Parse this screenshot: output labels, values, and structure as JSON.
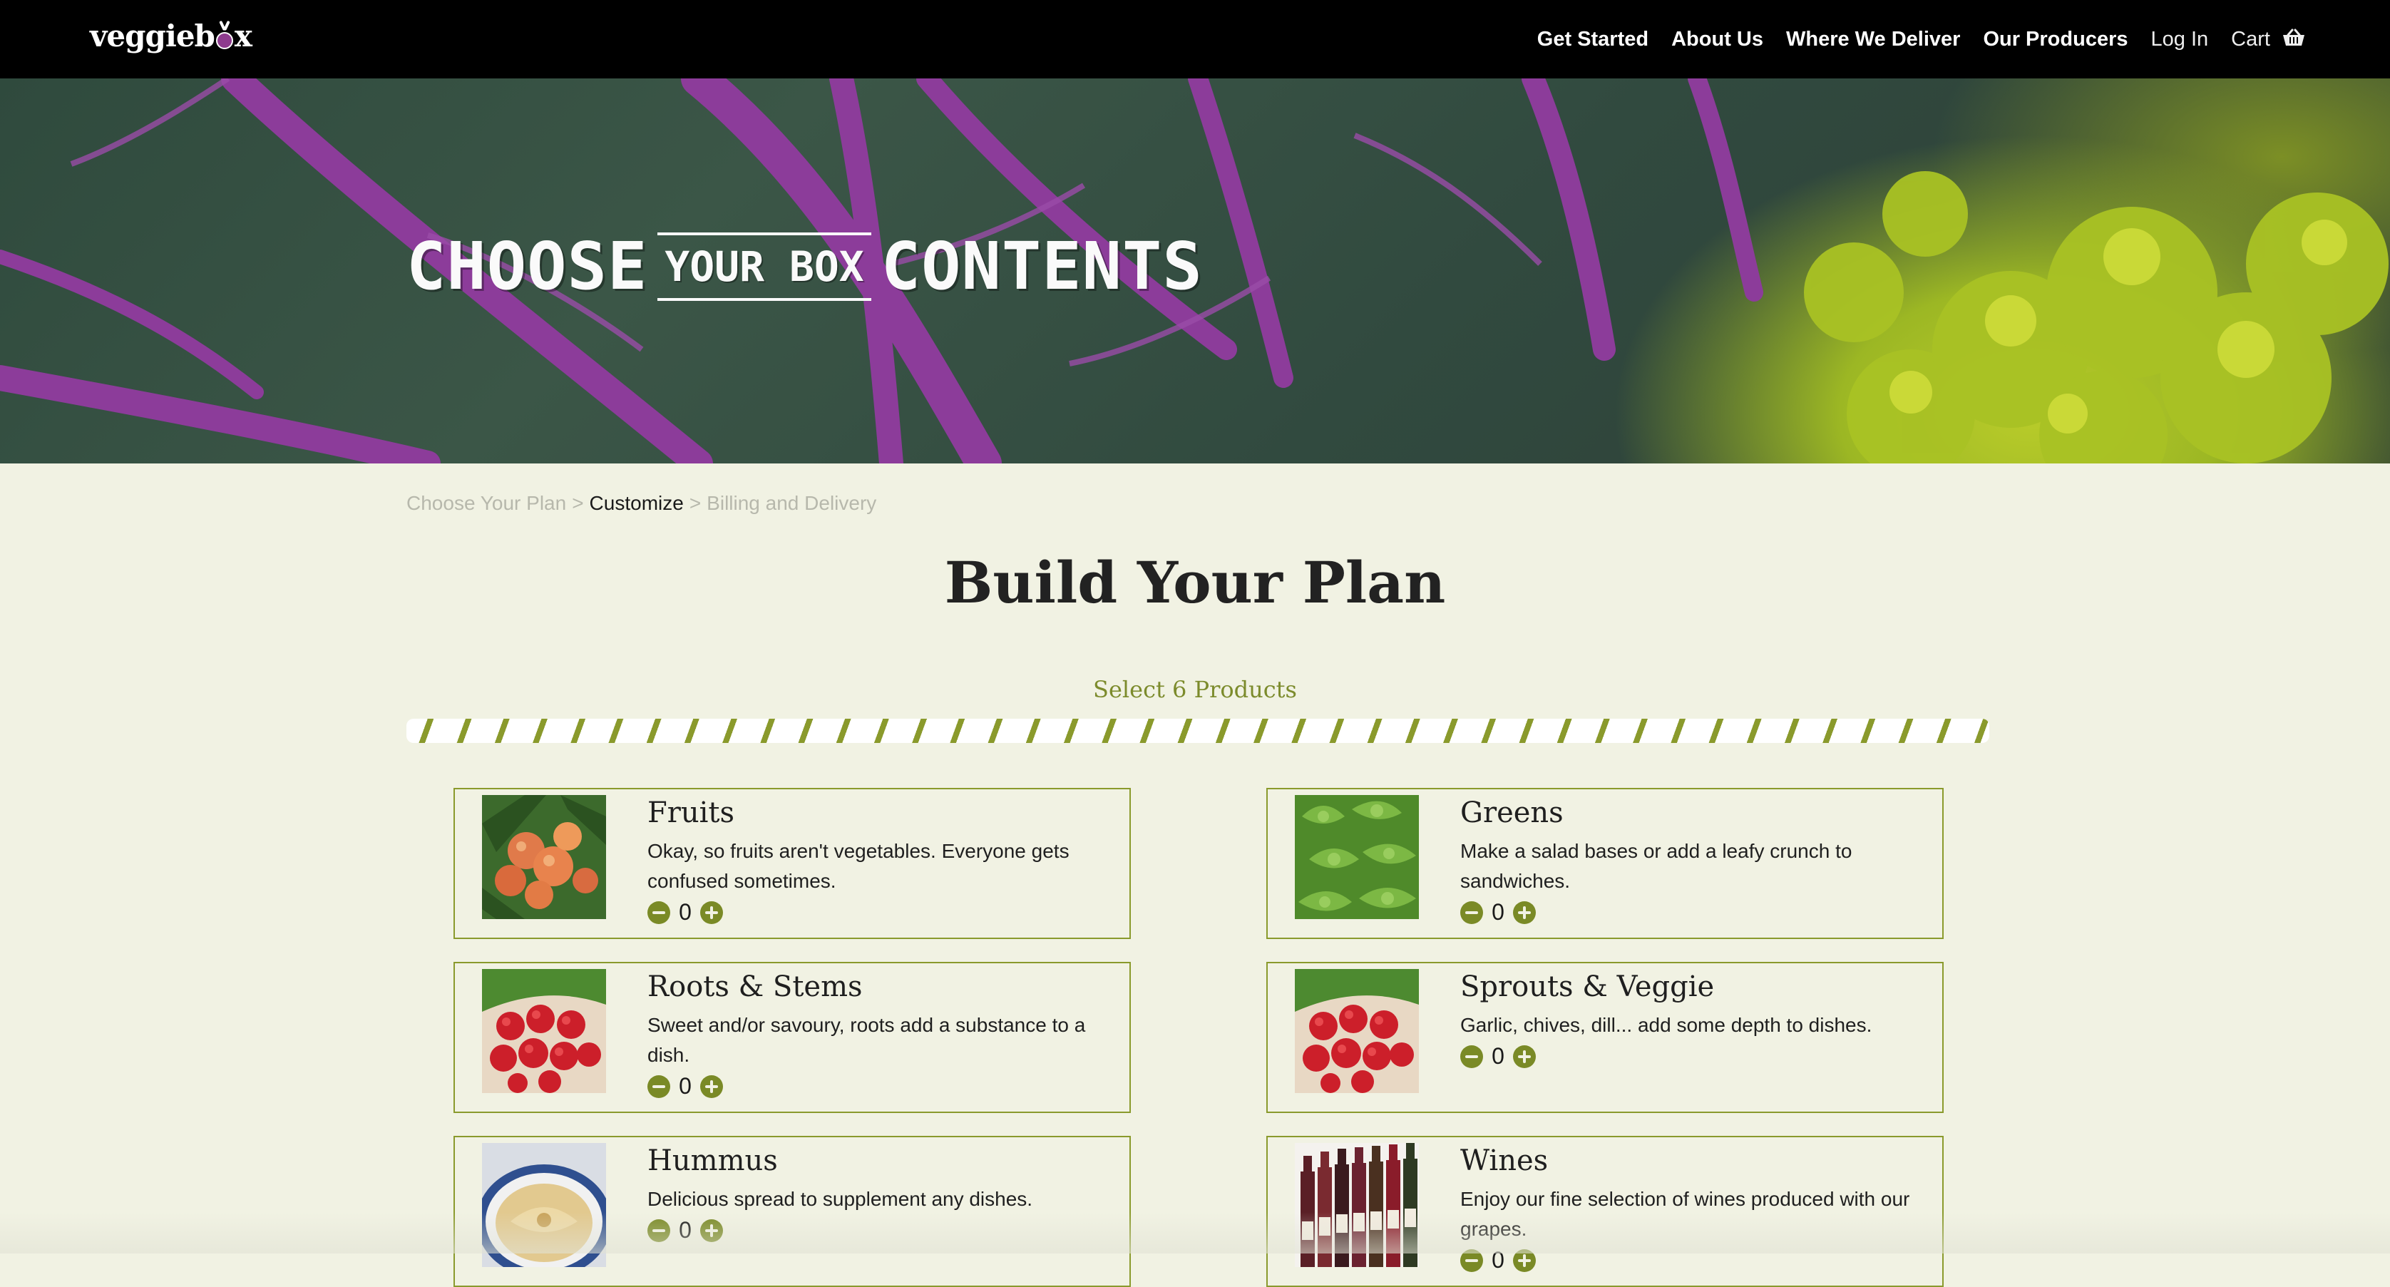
{
  "nav": {
    "logo": "veggieb",
    "logo_tail": "x",
    "links": [
      {
        "label": "Get Started"
      },
      {
        "label": "About Us"
      },
      {
        "label": "Where We Deliver"
      },
      {
        "label": "Our Producers"
      },
      {
        "label": "Log In"
      },
      {
        "label": "Cart"
      }
    ],
    "cart_icon": "basket-icon"
  },
  "hero": {
    "title_a": "CHOOSE",
    "title_b": "YOUR BOX",
    "title_c": "CONTENTS"
  },
  "breadcrumb": {
    "steps": [
      "Choose Your Plan",
      "Customize",
      "Billing and Delivery"
    ],
    "separator": ">",
    "active_index": 1
  },
  "page": {
    "title": "Build Your Plan",
    "select_label": "Select 6 Products",
    "progress_fraction": 0
  },
  "products": [
    {
      "name": "Fruits",
      "description": "Okay, so fruits aren't vegetables. Everyone gets confused sometimes.",
      "qty": "0",
      "image": "peaches-image"
    },
    {
      "name": "Greens",
      "description": "Make a salad bases or add a leafy crunch to sandwiches.",
      "qty": "0",
      "image": "lettuce-image"
    },
    {
      "name": "Roots & Stems",
      "description": "Sweet and/or savoury, roots add a substance to a dish.",
      "qty": "0",
      "image": "radishes-image"
    },
    {
      "name": "Sprouts & Veggie",
      "description": "Garlic, chives, dill... add some depth to dishes.",
      "qty": "0",
      "image": "radishes-image"
    },
    {
      "name": "Hummus",
      "description": "Delicious spread to supplement any dishes.",
      "qty": "0",
      "image": "hummus-image"
    },
    {
      "name": "Wines",
      "description": "Enjoy our fine selection of wines produced with our grapes.",
      "qty": "0",
      "image": "wine-bottles-image"
    }
  ],
  "colors": {
    "nav_bg": "#000000",
    "page_bg": "#f1f2e3",
    "accent": "#7a8a26",
    "beet": "#8e3b8e"
  }
}
